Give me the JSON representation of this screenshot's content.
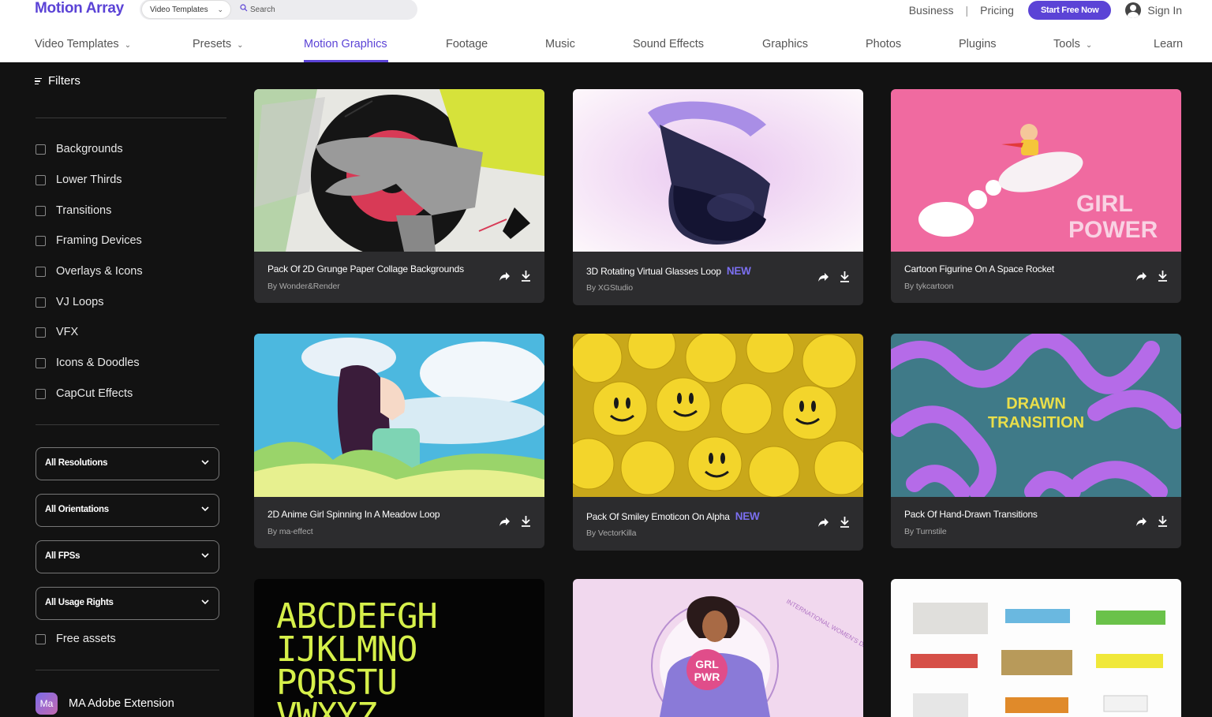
{
  "header": {
    "logo": "Motion Array",
    "search_type": "Video Templates",
    "search_placeholder": "Search",
    "links": [
      "Business",
      "Pricing"
    ],
    "start_button": "Start Free Now",
    "sign_in": "Sign In"
  },
  "nav": {
    "items": [
      {
        "label": "Video Templates"
      },
      {
        "label": "Presets"
      },
      {
        "label": "Motion Graphics"
      },
      {
        "label": "Footage"
      },
      {
        "label": "Music"
      },
      {
        "label": "Sound Effects"
      },
      {
        "label": "Graphics"
      },
      {
        "label": "Photos"
      },
      {
        "label": "Plugins"
      },
      {
        "label": "Tools"
      },
      {
        "label": "Learn"
      }
    ],
    "active": "Motion Graphics"
  },
  "sidebar": {
    "filters_label": "Filters",
    "categories": [
      "Backgrounds",
      "Lower Thirds",
      "Transitions",
      "Framing Devices",
      "Overlays & Icons",
      "VJ Loops",
      "VFX",
      "Icons & Doodles",
      "CapCut Effects"
    ],
    "selects": [
      "All Resolutions",
      "All Orientations",
      "All FPSs",
      "All Usage Rights"
    ],
    "free_assets": "Free assets",
    "extension_badge": "Ma",
    "extension_label": "MA Adobe Extension"
  },
  "cards": [
    {
      "title": "Pack Of 2D Grunge Paper Collage Backgrounds",
      "author": "By Wonder&Render",
      "badge": ""
    },
    {
      "title": "3D Rotating Virtual Glasses Loop",
      "author": "By XGStudio",
      "badge": "NEW"
    },
    {
      "title": "Cartoon Figurine On A Space Rocket",
      "author": "By tykcartoon",
      "badge": ""
    },
    {
      "title": "2D Anime Girl Spinning In A Meadow Loop",
      "author": "By ma-effect",
      "badge": ""
    },
    {
      "title": "Pack Of Smiley Emoticon On Alpha",
      "author": "By VectorKilla",
      "badge": "NEW"
    },
    {
      "title": "Pack Of Hand-Drawn Transitions",
      "author": "By Turnstile",
      "badge": ""
    }
  ],
  "thumb_text": {
    "girl_power": [
      "GIRL",
      "POWER"
    ],
    "drawn_transition": [
      "DRAWN",
      "TRANSITION"
    ],
    "alphabet_rows": [
      "ABCDEFGH",
      "IJKLMNO",
      "PQRSTU",
      "VWXYZ"
    ],
    "grl_pwr": [
      "GRL",
      "PWR"
    ],
    "womens_day": "INTERNATIONAL WOMEN'S DAY"
  },
  "colors": {
    "accent": "#5b43d6",
    "new_badge": "#7b6ff0",
    "background": "#121212",
    "card": "#2c2c2e"
  }
}
